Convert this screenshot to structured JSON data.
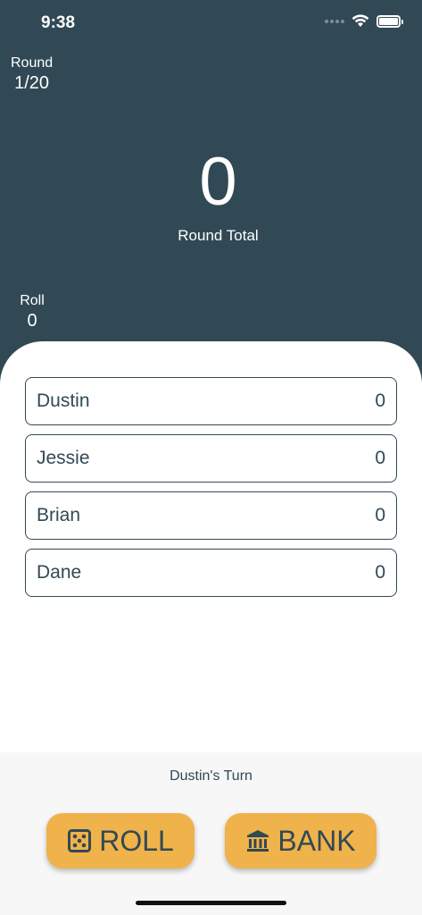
{
  "status_bar": {
    "time": "9:38"
  },
  "round": {
    "label": "Round",
    "value": "1/20"
  },
  "total": {
    "value": "0",
    "label": "Round Total"
  },
  "roll": {
    "label": "Roll",
    "value": "0"
  },
  "players": [
    {
      "name": "Dustin",
      "score": "0"
    },
    {
      "name": "Jessie",
      "score": "0"
    },
    {
      "name": "Brian",
      "score": "0"
    },
    {
      "name": "Dane",
      "score": "0"
    }
  ],
  "turn": {
    "text": "Dustin's Turn"
  },
  "actions": {
    "roll_label": "ROLL",
    "roll_icon": "dice-icon",
    "bank_label": "BANK",
    "bank_icon": "bank-icon"
  },
  "colors": {
    "primary": "#314955",
    "accent": "#f0b24a",
    "bottom_bg": "#f7f7f7"
  }
}
